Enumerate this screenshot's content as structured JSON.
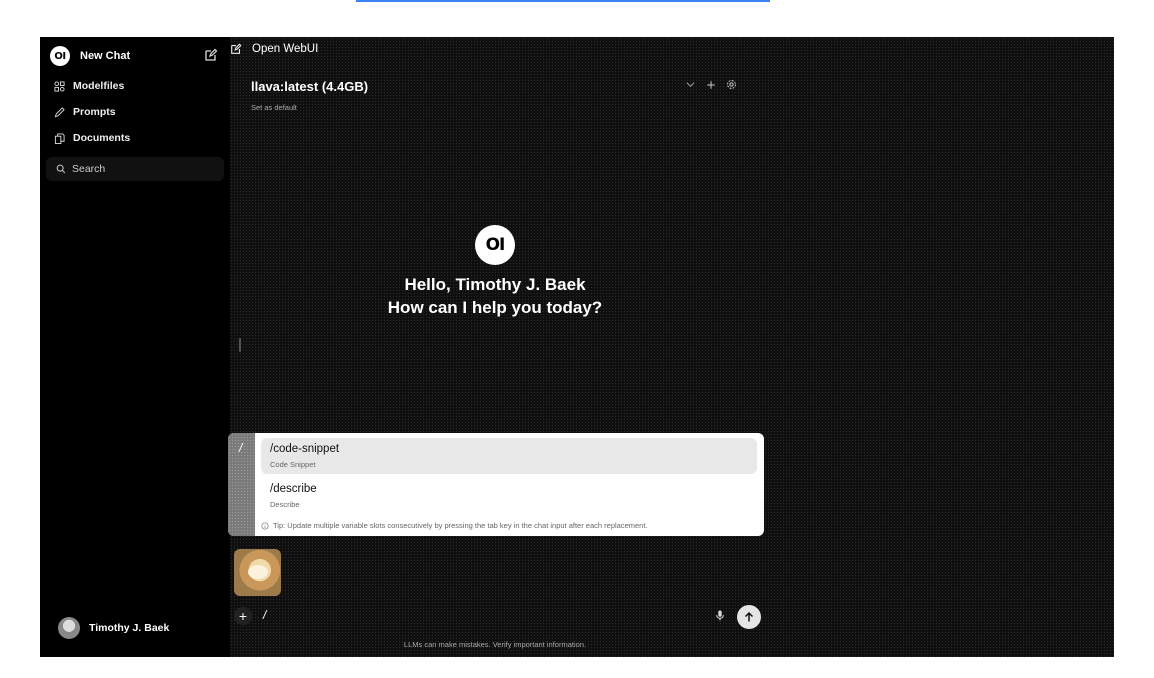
{
  "sidebar": {
    "logo_text": "OI",
    "new_chat_label": "New Chat",
    "items": [
      {
        "label": "Modelfiles",
        "icon": "modelfiles-icon"
      },
      {
        "label": "Prompts",
        "icon": "pencil-icon"
      },
      {
        "label": "Documents",
        "icon": "documents-icon"
      }
    ],
    "search_label": "Search",
    "user_name": "Timothy J. Baek"
  },
  "header": {
    "title": "Open WebUI"
  },
  "model_selector": {
    "model_name": "llava:latest (4.4GB)",
    "set_default_label": "Set as default"
  },
  "hero": {
    "logo_text": "OI",
    "greeting": "Hello, Timothy J. Baek",
    "subtitle": "How can I help you today?"
  },
  "command_popup": {
    "trigger": "/",
    "commands": [
      {
        "title": "/code-snippet",
        "description": "Code Snippet",
        "active": true
      },
      {
        "title": "/describe",
        "description": "Describe",
        "active": false
      }
    ],
    "tip": "Tip: Update multiple variable slots consecutively by pressing the tab key in the chat input after each replacement."
  },
  "chat_input": {
    "value": "/",
    "plus_label": "+"
  },
  "disclaimer": "LLMs can make mistakes. Verify important information.",
  "help_label": "?",
  "colors": {
    "accent_top_line": "#3b82f6",
    "sidebar_bg": "#000000",
    "main_bg": "#0f0f0f",
    "popup_bg": "#ffffff"
  }
}
